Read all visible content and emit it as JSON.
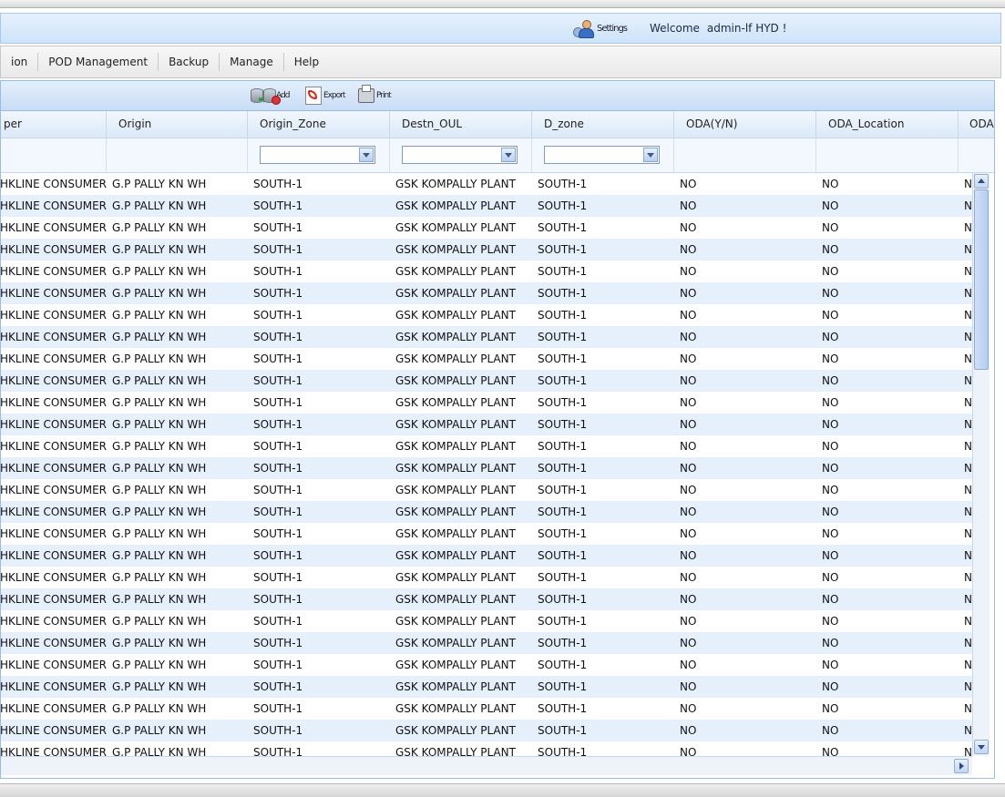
{
  "header": {
    "settings_label": "Settings",
    "welcome_label": "Welcome",
    "username": "admin-lf HYD !"
  },
  "menu": {
    "items": [
      "ion",
      "POD Management",
      "Backup",
      "Manage",
      "Help"
    ]
  },
  "toolbar": {
    "add_label": "Add",
    "export_label": "Export",
    "print_label": "Print"
  },
  "grid": {
    "columns": [
      "per",
      "Origin",
      "Origin_Zone",
      "Destn_OUL",
      "D_zone",
      "ODA(Y/N)",
      "ODA_Location",
      "ODA"
    ],
    "filters": [
      "",
      "",
      "",
      ""
    ],
    "row_template": {
      "shipper": "GLAXOSMITHKLINE CONSUMER",
      "origin": "G.P PALLY KN WH",
      "origin_zone": "SOUTH-1",
      "destn_oul": "GSK KOMPALLY PLANT",
      "d_zone": "SOUTH-1",
      "oda_yn": "NO",
      "oda_location": "NO",
      "oda": "NO"
    },
    "row_count": 27
  },
  "statusbar": {
    "text": ""
  },
  "colors": {
    "header_bg": "#d6e6fa",
    "row_alt": "#e6f0fd",
    "border": "#99bbe8"
  }
}
